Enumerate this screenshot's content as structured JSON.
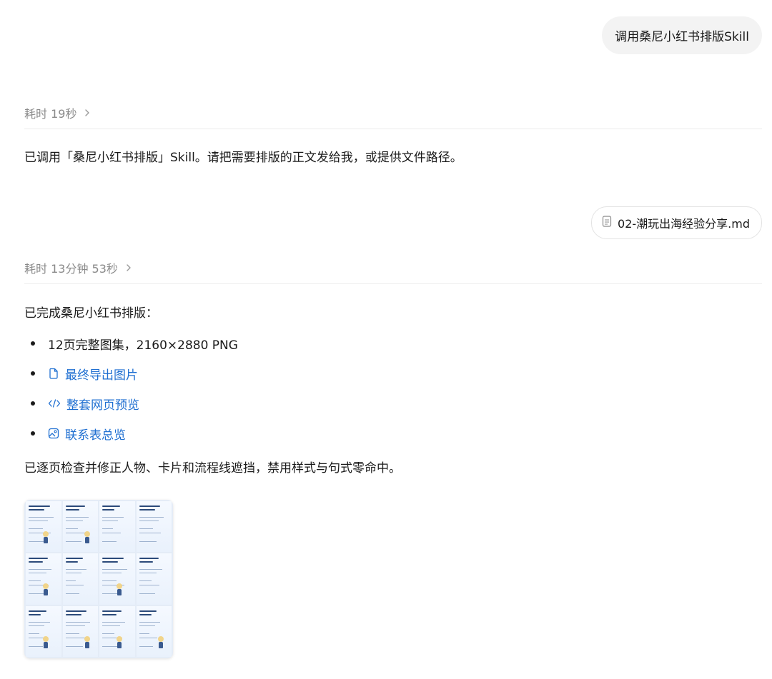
{
  "messages": {
    "user_prompt": "调用桑尼小红书排版Skill",
    "elapsed_1": "耗时 19秒",
    "reply_1": "已调用「桑尼小红书排版」Skill。请把需要排版的正文发给我，或提供文件路径。",
    "attachment_name": "02-潮玩出海经验分享.md",
    "elapsed_2": "耗时 13分钟 53秒",
    "reply_2_intro": "已完成桑尼小红书排版：",
    "bullets": {
      "item_1": "12页完整图集，2160×2880 PNG",
      "link_images": "最终导出图片",
      "link_web_preview": "整套网页预览",
      "link_contact_sheet": "联系表总览"
    },
    "reply_2_outro": "已逐页检查并修正人物、卡片和流程线遮挡，禁用样式与句式零命中。"
  },
  "icons": {
    "chevron": "chevron-right-icon",
    "file": "file-text-icon",
    "link_images": "file-icon",
    "link_web": "code-icon",
    "link_contact": "image-icon"
  },
  "colors": {
    "link": "#1f6fd1",
    "meta": "#8a8a8a",
    "bubble": "#f3f3f3"
  },
  "thumbnail": {
    "grid_columns": 4,
    "grid_rows": 3
  }
}
